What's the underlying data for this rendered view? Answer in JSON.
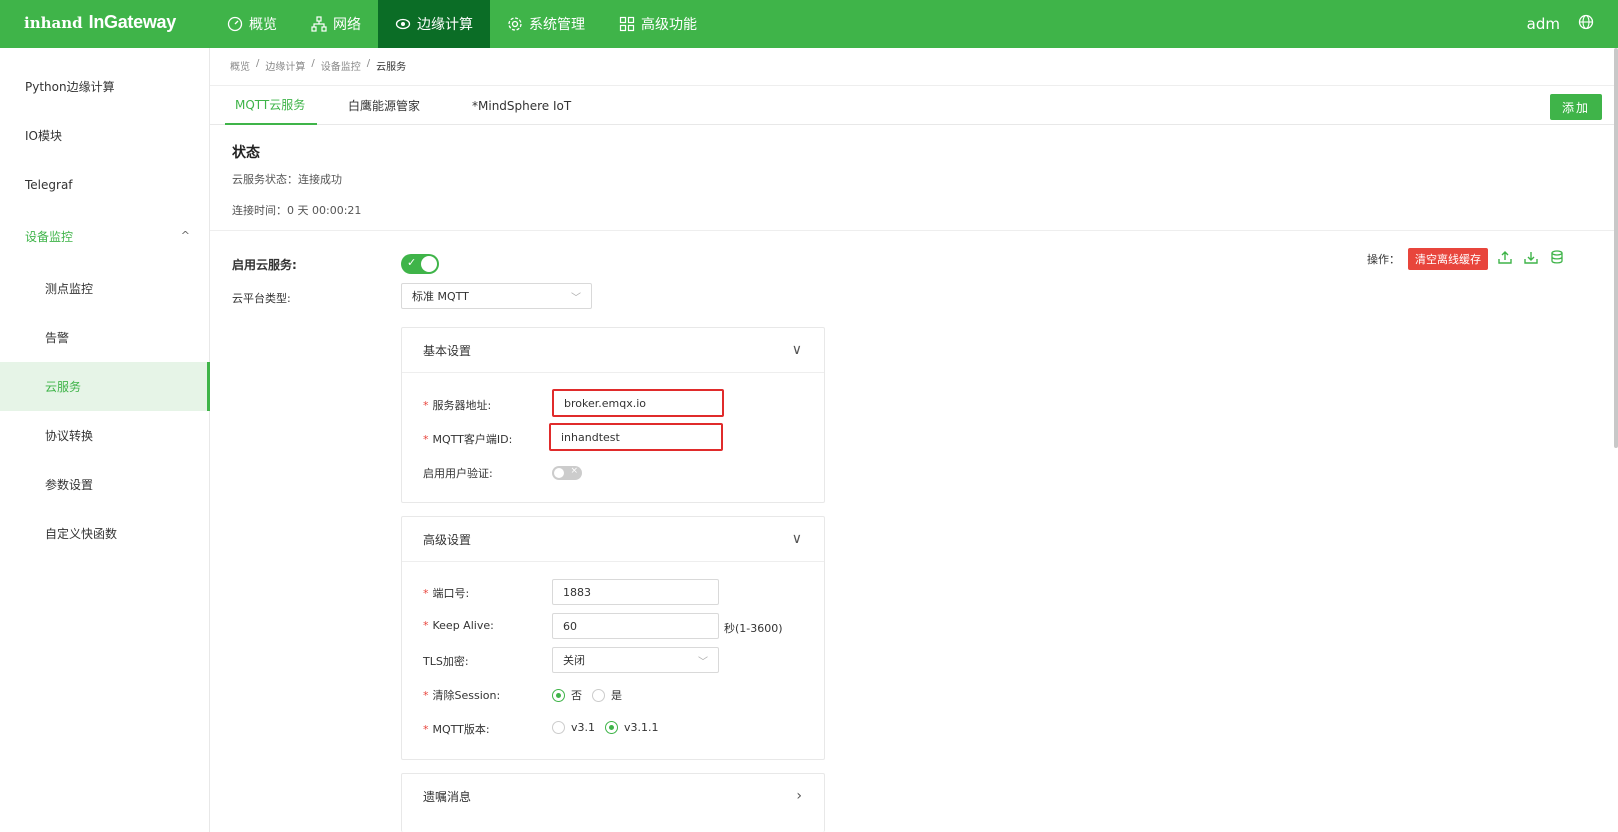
{
  "brand": {
    "mark": "inhand",
    "name": "InGateway"
  },
  "nav": [
    {
      "label": "概览",
      "icon": "dashboard-icon"
    },
    {
      "label": "网络",
      "icon": "network-icon"
    },
    {
      "label": "边缘计算",
      "icon": "edge-computing-icon"
    },
    {
      "label": "系统管理",
      "icon": "gear-icon"
    },
    {
      "label": "高级功能",
      "icon": "grid-icon"
    }
  ],
  "user": "adm",
  "sidebar": [
    {
      "label": "Python边缘计算"
    },
    {
      "label": "IO模块"
    },
    {
      "label": "Telegraf"
    },
    {
      "label": "设备监控"
    },
    {
      "label": "测点监控"
    },
    {
      "label": "告警"
    },
    {
      "label": "云服务"
    },
    {
      "label": "协议转换"
    },
    {
      "label": "参数设置"
    },
    {
      "label": "自定义快函数"
    }
  ],
  "breadcrumb": [
    "概览",
    "边缘计算",
    "设备监控",
    "云服务"
  ],
  "tabs": [
    "MQTT云服务",
    "白鹰能源管家",
    "*MindSphere IoT"
  ],
  "add_button": "添加",
  "status": {
    "title": "状态",
    "cloud_status": "云服务状态：连接成功",
    "connect_time": "连接时间：0 天 00:00:21"
  },
  "enable_label": "启用云服务:",
  "platform": {
    "label": "云平台类型:",
    "value": "标准 MQTT"
  },
  "ops": {
    "label": "操作：",
    "clear_button": "清空离线缓存"
  },
  "basic": {
    "title": "基本设置",
    "server_label": "服务器地址:",
    "server_value": "broker.emqx.io",
    "client_label": "MQTT客户端ID:",
    "client_value": "inhandtest",
    "auth_label": "启用用户验证:"
  },
  "advanced": {
    "title": "高级设置",
    "port_label": "端口号:",
    "port_value": "1883",
    "keepalive_label": "Keep Alive:",
    "keepalive_value": "60",
    "keepalive_unit": "秒(1-3600)",
    "tls_label": "TLS加密:",
    "tls_value": "关闭",
    "session_label": "清除Session:",
    "session_no": "否",
    "session_yes": "是",
    "version_label": "MQTT版本:",
    "v31": "v3.1",
    "v311": "v3.1.1"
  },
  "will": {
    "title": "遗嘱消息"
  }
}
